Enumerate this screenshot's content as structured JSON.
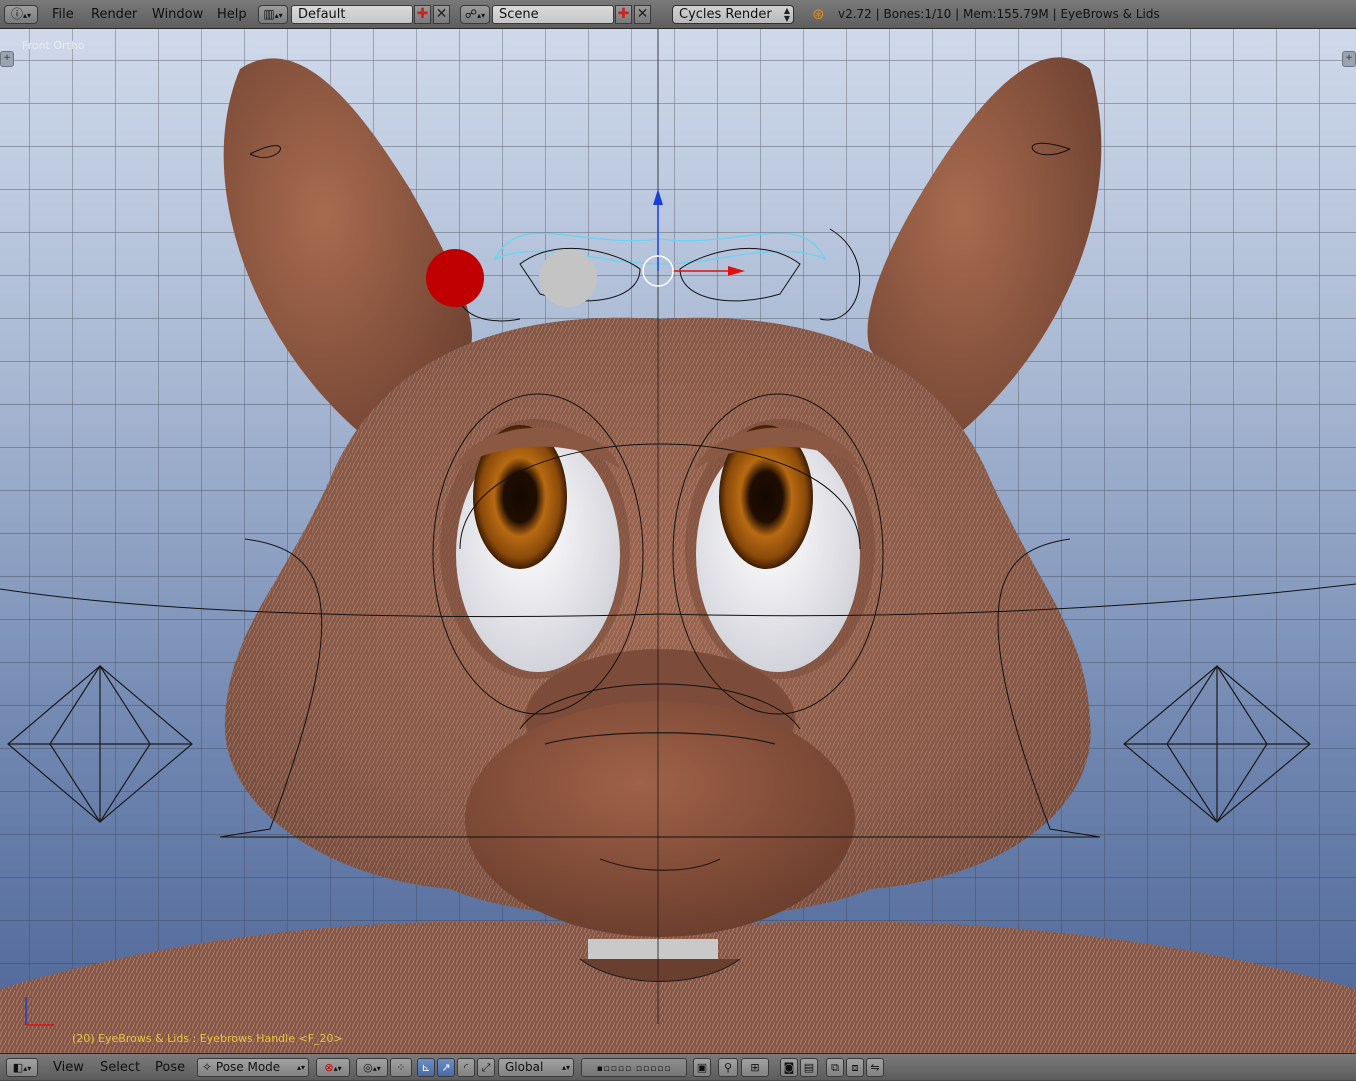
{
  "topbar": {
    "info_icon": "info-icon",
    "menus": [
      "File",
      "Render",
      "Window",
      "Help"
    ],
    "layout_name": "Default",
    "scene_name": "Scene",
    "render_engine": "Cycles Render",
    "status": "v2.72 | Bones:1/10 | Mem:155.79M | EyeBrows & Lids"
  },
  "viewport": {
    "view_label": "Front Ortho",
    "object_label": "(20) EyeBrows & Lids : Eyebrows Handle <F_20>",
    "label_color": "#e9c53b"
  },
  "bottombar": {
    "menus": [
      "View",
      "Select",
      "Pose"
    ],
    "mode": "Pose Mode",
    "orientation": "Global"
  },
  "colors": {
    "fur": "#8b5a45",
    "fur_light": "#a56a50",
    "iris": "#a0590f",
    "red_handle": "#c00000",
    "grey_handle": "#c4c4c4",
    "axis_blue": "#1a3fd6",
    "axis_red": "#e01010"
  }
}
